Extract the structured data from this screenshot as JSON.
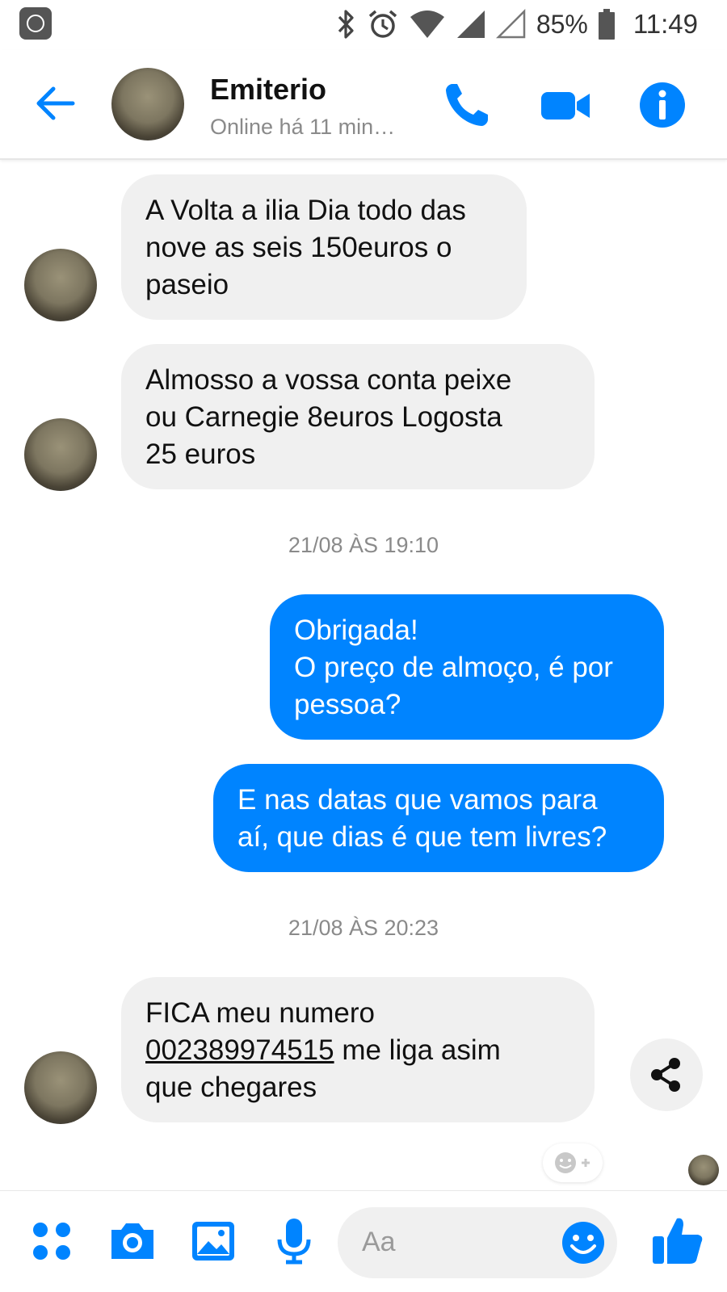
{
  "status_bar": {
    "battery": "85%",
    "time": "11:49"
  },
  "header": {
    "contact_name": "Emiterio",
    "presence": "Online há 11 min…"
  },
  "messages": [
    {
      "direction": "incoming",
      "lines": [
        "A Volta a ilia Dia todo das",
        "nove as seis 150euros o",
        "paseio"
      ]
    },
    {
      "direction": "incoming",
      "lines": [
        "Almosso a vossa conta  peixe",
        "ou Carnegie 8euros Logosta",
        "25 euros"
      ]
    },
    {
      "direction": "timestamp",
      "text": "21/08 ÀS 19:10"
    },
    {
      "direction": "outgoing",
      "lines": [
        "Obrigada!",
        "O preço de almoço, é por",
        "pessoa?"
      ]
    },
    {
      "direction": "outgoing",
      "lines": [
        "E nas datas que vamos para",
        "aí, que dias é que tem livres?"
      ]
    },
    {
      "direction": "timestamp",
      "text": "21/08 ÀS 20:23"
    },
    {
      "direction": "incoming",
      "line1": "FICA meu numero",
      "phone": "002389974515",
      "line2_rest": " me liga asim",
      "line3": "que chegares"
    }
  ],
  "composer": {
    "placeholder": "Aa"
  },
  "colors": {
    "accent": "#0084ff",
    "incoming_bubble": "#f0f0f0",
    "muted_text": "#8a8a8a"
  },
  "icons": [
    "back-arrow-icon",
    "phone-icon",
    "video-camera-icon",
    "info-icon",
    "share-icon",
    "add-reaction-icon",
    "more-icon",
    "camera-icon",
    "gallery-icon",
    "microphone-icon",
    "emoji-icon",
    "thumbs-up-icon",
    "bluetooth-icon",
    "alarm-icon",
    "wifi-icon",
    "signal-icon",
    "battery-icon"
  ]
}
